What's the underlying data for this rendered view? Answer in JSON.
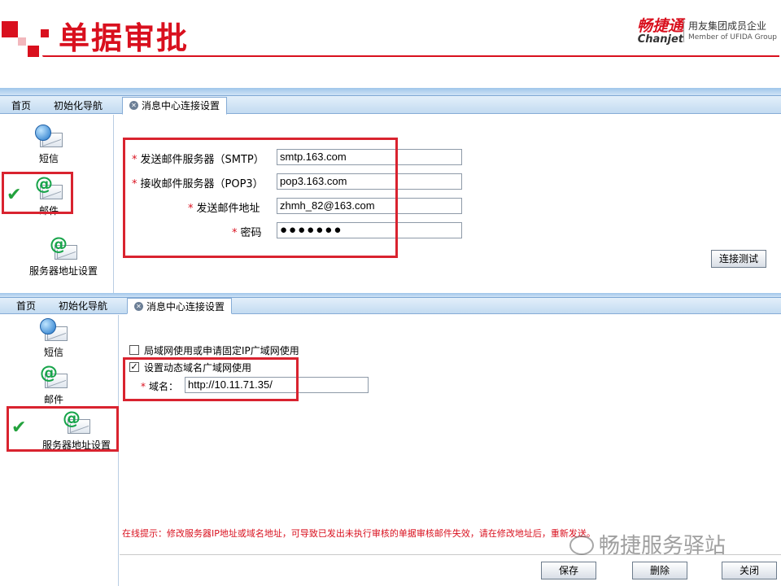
{
  "header": {
    "title": "单据审批",
    "brand_cn": "畅捷通",
    "brand_en": "Chanjet",
    "member_cn": "用友集团成员企业",
    "member_en": "Member of UFIDA Group"
  },
  "panel1": {
    "tabs": [
      "首页",
      "初始化导航",
      "消息中心连接设置"
    ],
    "nav": [
      {
        "label": "短信",
        "icon": "sms-icon"
      },
      {
        "label": "邮件",
        "icon": "email-icon",
        "selected": true
      },
      {
        "label": "服务器地址设置",
        "icon": "server-address-icon"
      }
    ],
    "fields": [
      {
        "label": "发送邮件服务器（SMTP）",
        "value": "smtp.163.com"
      },
      {
        "label": "接收邮件服务器（POP3）",
        "value": "pop3.163.com"
      },
      {
        "label": "发送邮件地址",
        "value": "zhmh_82@163.com"
      },
      {
        "label": "密码",
        "value": "●●●●●●●"
      }
    ],
    "required_mark": "*",
    "connect_test_button": "连接测试"
  },
  "panel2": {
    "tabs": [
      "首页",
      "初始化导航",
      "消息中心连接设置"
    ],
    "nav": [
      {
        "label": "短信",
        "icon": "sms-icon"
      },
      {
        "label": "邮件",
        "icon": "email-icon"
      },
      {
        "label": "服务器地址设置",
        "icon": "server-address-icon",
        "selected": true
      }
    ],
    "option_lan": "局域网使用或申请固定IP广域网使用",
    "option_lan_checked": false,
    "option_dynamic": "设置动态域名广域网使用",
    "option_dynamic_checked": true,
    "check_mark": "✓",
    "domain_label": "域名：",
    "domain_value": "http://10.11.71.35/",
    "required_mark": "*",
    "hint": "在线提示：修改服务器IP地址或域名地址，可导致已发出未执行审核的单据审核邮件失效，请在修改地址后，重新发送。",
    "buttons": {
      "save": "保存",
      "delete": "删除",
      "close": "关闭"
    }
  },
  "watermark": "畅捷服务驿站",
  "colors": {
    "accent": "#d9101e",
    "tab_bar": "#c3dbf1",
    "check": "#23a23d"
  }
}
